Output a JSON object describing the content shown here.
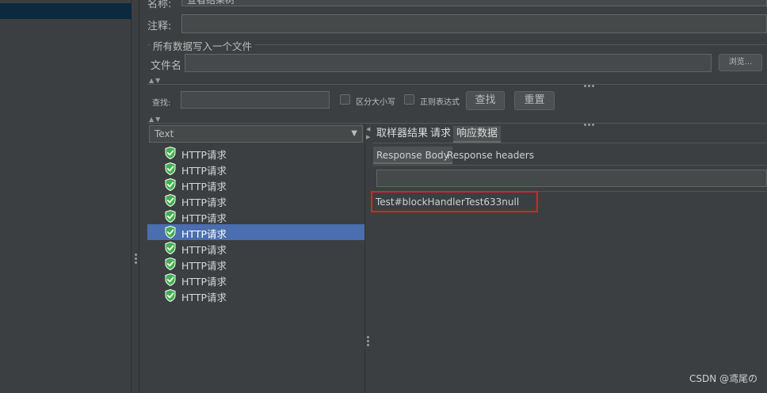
{
  "form": {
    "name_label": "名称:",
    "name_value": "查看结果树",
    "comment_label": "注释:",
    "comment_value": "",
    "section_title": "所有数据写入一个文件",
    "filename_label": "文件名",
    "filename_value": "",
    "browse_label": "浏览..."
  },
  "search": {
    "label": "查找:",
    "value": "",
    "case_label": "区分大小写",
    "regex_label": "正则表达式",
    "find_button": "查找",
    "reset_button": "重置"
  },
  "renderer": {
    "selected": "Text"
  },
  "tree": {
    "items": [
      {
        "label": "HTTP请求"
      },
      {
        "label": "HTTP请求"
      },
      {
        "label": "HTTP请求"
      },
      {
        "label": "HTTP请求"
      },
      {
        "label": "HTTP请求"
      },
      {
        "label": "HTTP请求",
        "selected": true
      },
      {
        "label": "HTTP请求"
      },
      {
        "label": "HTTP请求"
      },
      {
        "label": "HTTP请求"
      },
      {
        "label": "HTTP请求"
      }
    ]
  },
  "tabs": {
    "sampler_result": "取样器结果",
    "request": "请求",
    "response_data": "响应数据",
    "active": "响应数据"
  },
  "subtabs": {
    "response_body": "Response Body",
    "response_headers": "Response headers",
    "active": "Response Body"
  },
  "response": {
    "search_value": "",
    "body_text": "Test#blockHandlerTest633null"
  },
  "watermark": "CSDN @鸢尾の",
  "colors": {
    "panel_bg": "#3c3f41",
    "selection": "#4b6eaf",
    "highlight_box": "#e0202a",
    "success_icon": "#3fb24a"
  }
}
